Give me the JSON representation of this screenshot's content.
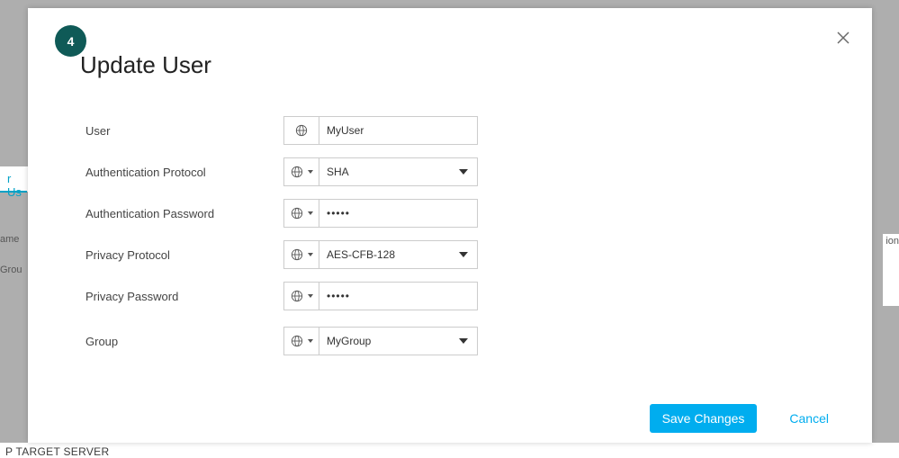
{
  "background": {
    "left_tab_fragment": "r Us",
    "col_left_1": "ame",
    "col_left_2": "Grou",
    "col_right_1": "ion",
    "bottom_text": "P TARGET SERVER"
  },
  "modal": {
    "step_number": "4",
    "title": "Update User",
    "close_icon": "close",
    "fields": {
      "user": {
        "label": "User",
        "value": "MyUser",
        "type": "text",
        "globe_has_caret": false
      },
      "auth_proto": {
        "label": "Authentication Protocol",
        "value": "SHA",
        "type": "select",
        "globe_has_caret": true
      },
      "auth_pass": {
        "label": "Authentication Password",
        "value": "•••••",
        "type": "password",
        "globe_has_caret": true
      },
      "priv_proto": {
        "label": "Privacy Protocol",
        "value": "AES-CFB-128",
        "type": "select",
        "globe_has_caret": true
      },
      "priv_pass": {
        "label": "Privacy Password",
        "value": "•••••",
        "type": "password",
        "globe_has_caret": true
      },
      "group": {
        "label": "Group",
        "value": "MyGroup",
        "type": "select",
        "globe_has_caret": true
      }
    },
    "buttons": {
      "save": "Save Changes",
      "cancel": "Cancel"
    }
  },
  "colors": {
    "badge_bg": "#0f5a57",
    "primary": "#00adef"
  }
}
